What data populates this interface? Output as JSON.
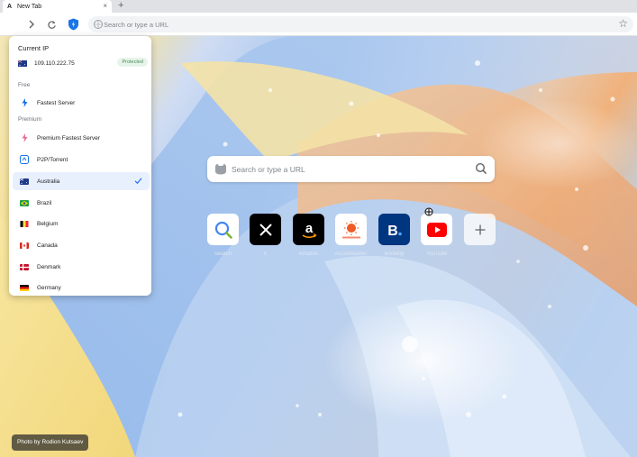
{
  "tab": {
    "title": "New Tab",
    "close": "×",
    "new_tab": "+"
  },
  "toolbar": {
    "forward": "›",
    "reload": "↻",
    "address_placeholder": "Search or type a URL",
    "star": "☆"
  },
  "ntp": {
    "search_placeholder": "Search or type a URL",
    "tiles": [
      {
        "label": "Search",
        "icon": "magnifier-icon"
      },
      {
        "label": "X",
        "icon": "x-logo-icon"
      },
      {
        "label": "Amazon",
        "icon": "amazon-logo-icon"
      },
      {
        "label": "AccuWeather",
        "icon": "accuweather-icon"
      },
      {
        "label": "Booking",
        "icon": "booking-logo-icon"
      },
      {
        "label": "YouTube",
        "icon": "youtube-logo-icon"
      },
      {
        "label": "",
        "icon": "add-icon"
      }
    ],
    "credit": "Photo by Rodion Kutsaev"
  },
  "vpn": {
    "current_ip_label": "Current IP",
    "ip": "109.110.222.75",
    "status": "Protected",
    "free_label": "Free",
    "premium_label": "Premium",
    "items": [
      {
        "label": "Fastest Server",
        "icon": "lightning-icon"
      },
      {
        "label": "Premium Fastest Server",
        "icon": "premium-lightning-icon"
      },
      {
        "label": "P2P/Torrent",
        "icon": "p2p-icon"
      },
      {
        "label": "Australia",
        "icon": "flag-australia",
        "selected": true
      },
      {
        "label": "Brazil",
        "icon": "flag-brazil"
      },
      {
        "label": "Belgium",
        "icon": "flag-belgium"
      },
      {
        "label": "Canada",
        "icon": "flag-canada"
      },
      {
        "label": "Denmark",
        "icon": "flag-denmark"
      },
      {
        "label": "Germany",
        "icon": "flag-germany"
      }
    ]
  },
  "colors": {
    "accent": "#1a73e8",
    "protected_bg": "#e6f4ea",
    "selected_bg": "#e8f0fe"
  }
}
